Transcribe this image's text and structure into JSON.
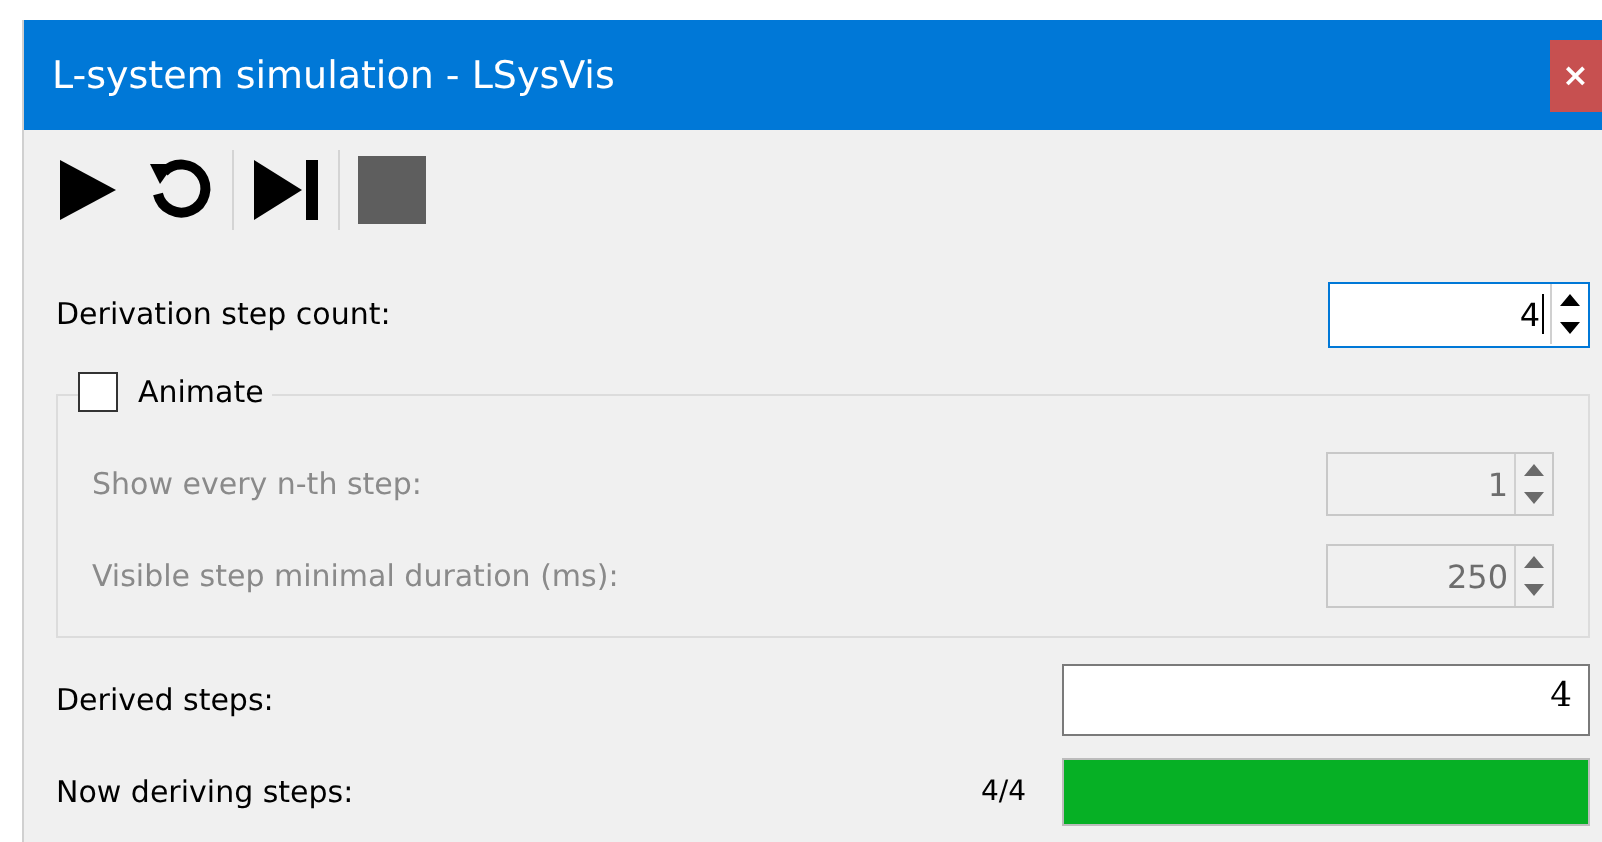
{
  "window": {
    "title": "L-system simulation - LSysVis",
    "close_label": "×"
  },
  "toolbar": [
    {
      "kind": "play",
      "disabled": false
    },
    {
      "kind": "reset",
      "disabled": false
    },
    {
      "kind": "step",
      "disabled": false
    },
    {
      "kind": "stop",
      "disabled": true
    }
  ],
  "step_count": {
    "label": "Derivation step count:",
    "value": "4",
    "focused": true
  },
  "animate": {
    "label": "Animate",
    "checked": false,
    "fields": [
      {
        "label": "Show every n-th step:",
        "value": "1",
        "disabled": true
      },
      {
        "label": "Visible step minimal duration (ms):",
        "value": "250",
        "disabled": true
      }
    ]
  },
  "derived": {
    "label": "Derived steps:",
    "value": "4"
  },
  "deriving": {
    "label": "Now deriving steps:",
    "reading": "4/4",
    "level": 1
  }
}
